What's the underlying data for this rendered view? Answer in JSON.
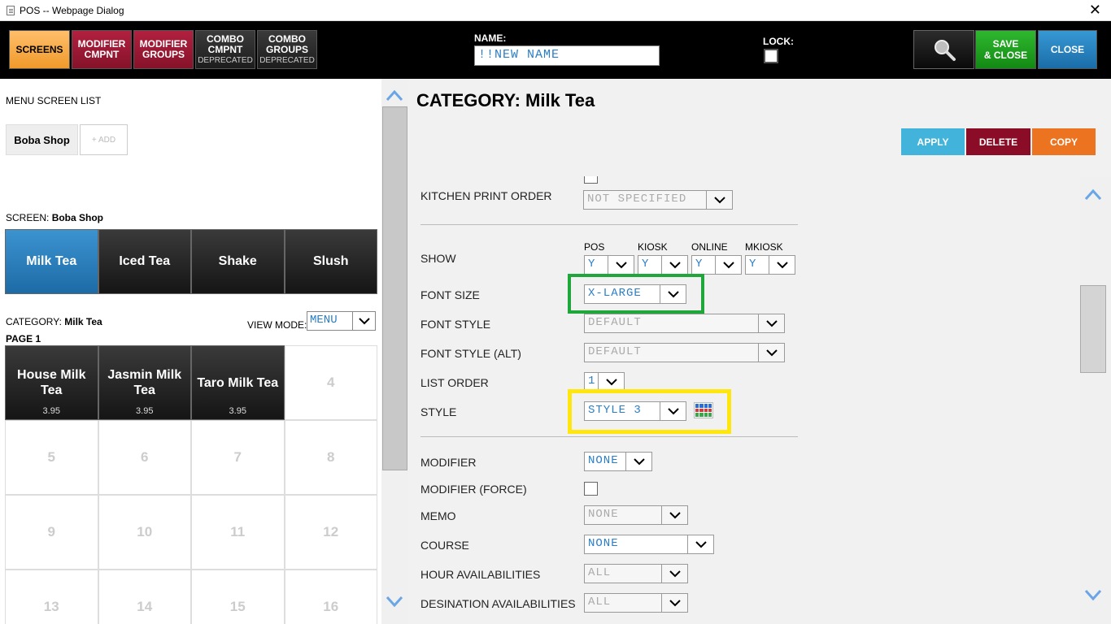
{
  "window": {
    "title": "POS -- Webpage Dialog",
    "close": "✕"
  },
  "topbar": {
    "screens": "SCREENS",
    "modifier_cmpnt": [
      "MODIFIER",
      "CMPNT"
    ],
    "modifier_groups": [
      "MODIFIER",
      "GROUPS"
    ],
    "combo_cmpnt": [
      "COMBO",
      "CMPNT",
      "DEPRECATED"
    ],
    "combo_groups": [
      "COMBO",
      "GROUPS",
      "DEPRECATED"
    ],
    "name_label": "NAME:",
    "name_value": "!!NEW NAME",
    "lock_label": "LOCK:",
    "save": [
      "SAVE",
      "& CLOSE"
    ],
    "close": "CLOSE"
  },
  "left": {
    "menu_screen_list": "MENU SCREEN LIST",
    "screen_tab": "Boba Shop",
    "add_tab": "+ ADD",
    "screen_label": "SCREEN:",
    "screen_name": "Boba Shop",
    "categories": [
      "Milk Tea",
      "Iced Tea",
      "Shake",
      "Slush"
    ],
    "category_label": "CATEGORY:",
    "category_name": "Milk Tea",
    "view_mode_label": "VIEW MODE:",
    "view_mode_value": "MENU",
    "page_label": "PAGE 1",
    "items": [
      {
        "name": "House Milk Tea",
        "price": "3.95"
      },
      {
        "name": "Jasmin Milk Tea",
        "price": "3.95"
      },
      {
        "name": "Taro Milk Tea",
        "price": "3.95"
      }
    ],
    "empty_cells": [
      "4",
      "5",
      "6",
      "7",
      "8",
      "9",
      "10",
      "11",
      "12",
      "13",
      "14",
      "15",
      "16"
    ]
  },
  "right": {
    "title": "CATEGORY: Milk Tea",
    "apply": "APPLY",
    "delete": "DELETE",
    "copy": "COPY",
    "kitchen_print_order_label": "KITCHEN PRINT ORDER",
    "kitchen_print_order_value": "NOT SPECIFIED",
    "show_label": "SHOW",
    "show_cols": [
      "POS",
      "KIOSK",
      "ONLINE",
      "MKIOSK"
    ],
    "show_values": [
      "Y",
      "Y",
      "Y",
      "Y"
    ],
    "font_size_label": "FONT SIZE",
    "font_size_value": "X-LARGE",
    "font_style_label": "FONT STYLE",
    "font_style_value": "DEFAULT",
    "font_style_alt_label": "FONT STYLE (ALT)",
    "font_style_alt_value": "DEFAULT",
    "list_order_label": "LIST ORDER",
    "list_order_value": "1",
    "style_label": "STYLE",
    "style_value": "STYLE 3",
    "modifier_label": "MODIFIER",
    "modifier_value": "NONE",
    "modifier_force_label": "MODIFIER (FORCE)",
    "memo_label": "MEMO",
    "memo_value": "NONE",
    "course_label": "COURSE",
    "course_value": "NONE",
    "hour_avail_label": "HOUR AVAILABILITIES",
    "hour_avail_value": "ALL",
    "dest_avail_label": "DESINATION AVAILABILITIES",
    "dest_avail_value": "ALL"
  },
  "colors": {
    "accent_blue": "#2a7ec8",
    "green_highlight": "#20a73b",
    "yellow_highlight": "#ffe60f"
  }
}
